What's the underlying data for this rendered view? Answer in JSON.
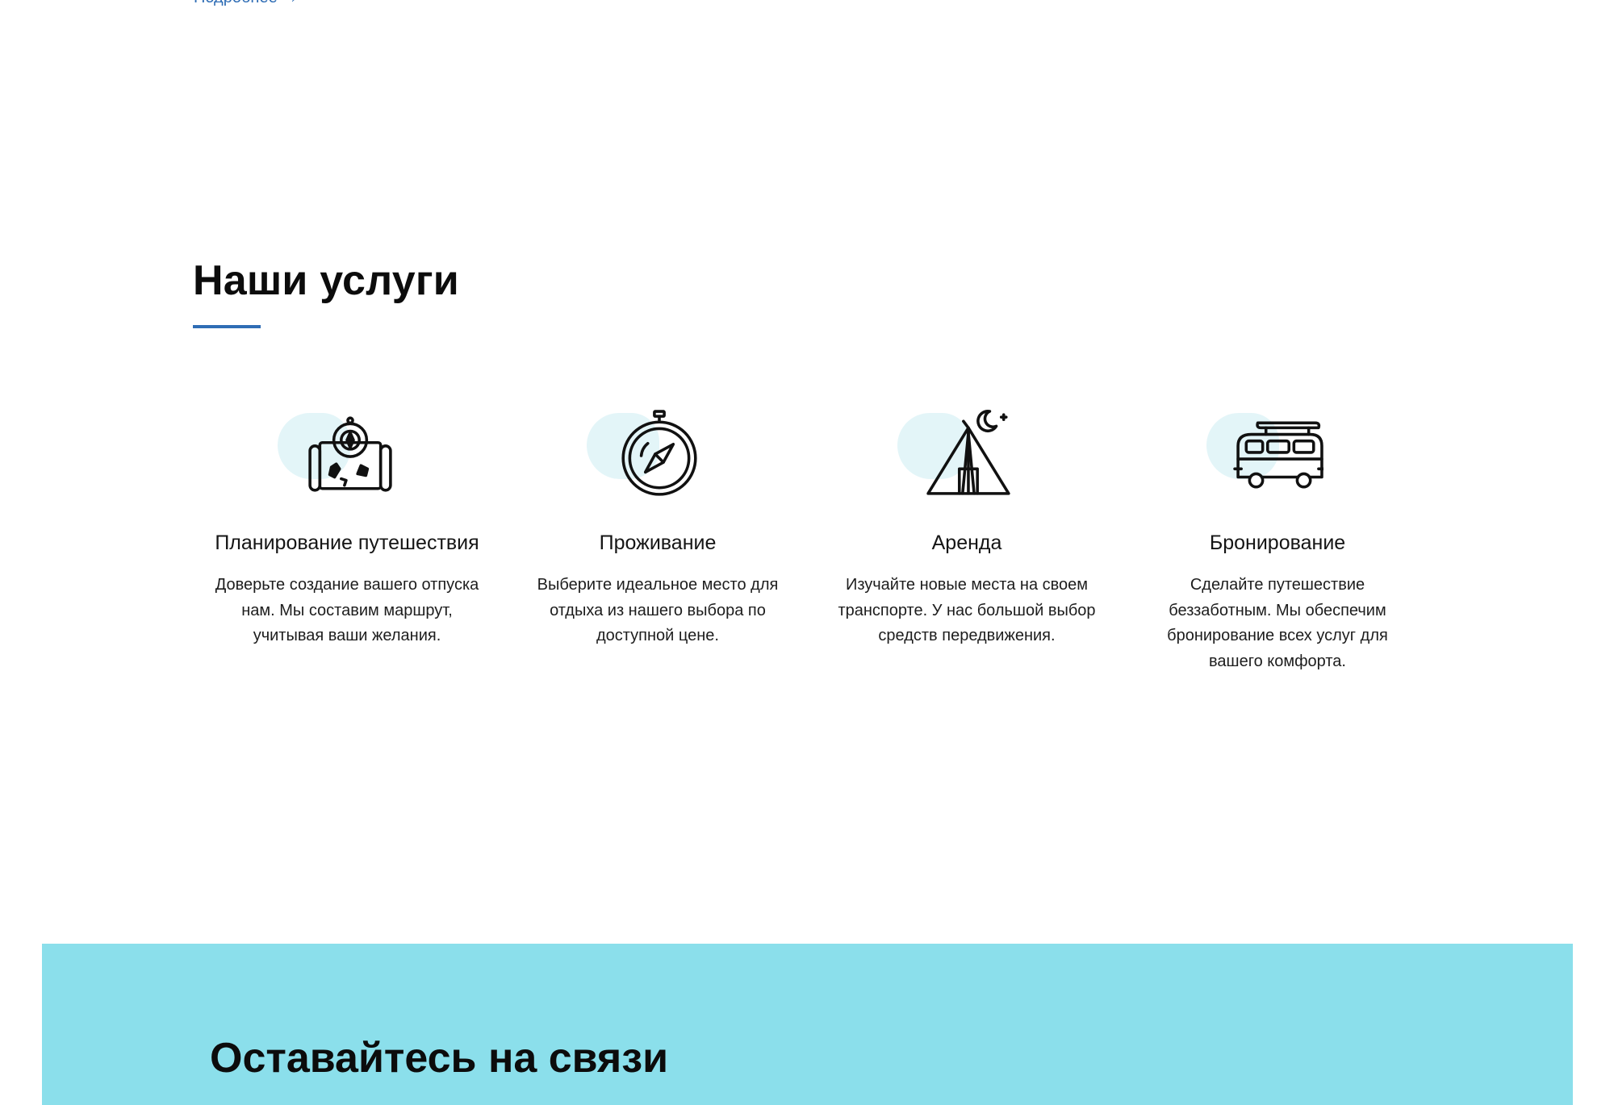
{
  "top_link": {
    "label": "Подробнее →"
  },
  "services": {
    "title": "Наши услуги",
    "accent_color": "#2f6db5",
    "items": [
      {
        "icon": "treasure-map-compass-icon",
        "title": "Планирование путешествия",
        "text": "Доверьте создание вашего отпуска нам. Мы составим маршрут, учитывая ваши желания."
      },
      {
        "icon": "compass-icon",
        "title": "Проживание",
        "text": "Выберите идеальное место для отдыха из нашего выбора по доступной цене."
      },
      {
        "icon": "tent-moon-icon",
        "title": "Аренда",
        "text": "Изучайте новые места на своем транспорте. У нас большой выбор средств передвижения."
      },
      {
        "icon": "camper-van-icon",
        "title": "Бронирование",
        "text": "Сделайте путешествие беззаботным. Мы обеспечим бронирование всех услуг для вашего комфорта."
      }
    ]
  },
  "contact": {
    "title": "Оставайтесь на связи",
    "background_color": "#8bdfeb"
  }
}
